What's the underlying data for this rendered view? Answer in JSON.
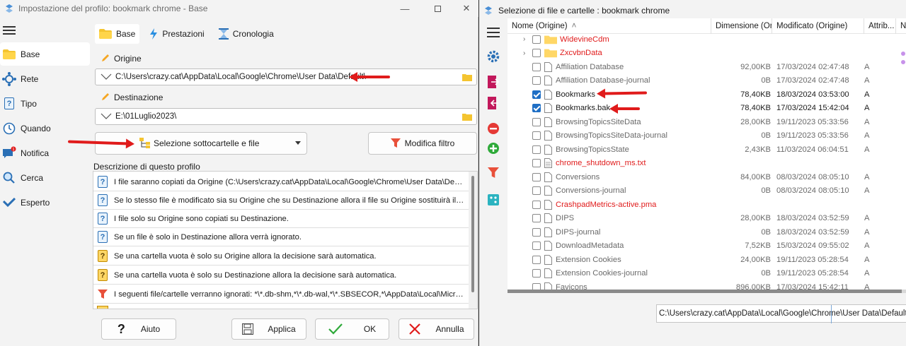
{
  "left_window": {
    "title": "Impostazione del profilo: bookmark chrome - Base",
    "sidebar": [
      {
        "label": "Base",
        "icon": "folder-icon",
        "active": true
      },
      {
        "label": "Rete",
        "icon": "network-icon",
        "active": false
      },
      {
        "label": "Tipo",
        "icon": "question-doc-icon",
        "active": false
      },
      {
        "label": "Quando",
        "icon": "clock-icon",
        "active": false
      },
      {
        "label": "Notifica",
        "icon": "notification-icon",
        "active": false
      },
      {
        "label": "Cerca",
        "icon": "search-icon",
        "active": false
      },
      {
        "label": "Esperto",
        "icon": "check-icon",
        "active": false
      }
    ],
    "tabs": [
      {
        "label": "Base",
        "icon": "folder-icon"
      },
      {
        "label": "Prestazioni",
        "icon": "lightning-icon"
      },
      {
        "label": "Cronologia",
        "icon": "hourglass-icon"
      }
    ],
    "origin_label": "Origine",
    "origin_value": "C:\\Users\\crazy.cat\\AppData\\Local\\Google\\Chrome\\User Data\\Default\\",
    "dest_label": "Destinazione",
    "dest_value": "E:\\01Luglio2023\\",
    "select_button": "Selezione sottocartelle e file",
    "filter_button": "Modifica filtro",
    "desc_title": "Descrizione di questo profilo",
    "descriptions": [
      {
        "text": "I file saranno copiati da Origine (C:\\Users\\crazy.cat\\AppData\\Local\\Google\\Chrome\\User Data\\Default\\) a ...",
        "icon": "question-doc-icon"
      },
      {
        "text": "Se lo stesso file è modificato sia su Origine che su Destinazione allora il file su Origine sostituirà il file su De...",
        "icon": "question-doc-icon"
      },
      {
        "text": "I file solo su Origine sono copiati su Destinazione.",
        "icon": "question-doc-icon"
      },
      {
        "text": "Se un file è solo in Destinazione allora verrà ignorato.",
        "icon": "question-doc-icon"
      },
      {
        "text": "Se una cartella vuota è solo su Origine allora la decisione sarà automatica.",
        "icon": "question-folder-icon"
      },
      {
        "text": "Se una cartella vuota è solo su Destinazione allora la decisione sarà automatica.",
        "icon": "question-folder-icon"
      },
      {
        "text": "I seguenti file/cartelle verranno ignorati: *\\*.db-shm,*\\*.db-wal,*\\*.SBSECOR,*\\AppData\\Local\\Microsoft\\Win...",
        "icon": "filter-icon"
      }
    ],
    "footer": {
      "help": "Aiuto",
      "apply": "Applica",
      "ok": "OK",
      "cancel": "Annulla"
    }
  },
  "right_window": {
    "title": "Selezione di file e cartelle : bookmark chrome",
    "columns": [
      "Nome (Origine)",
      "Dimensione (Ori...",
      "Modificato (Origine)",
      "Attrib...",
      "N"
    ],
    "rows": [
      {
        "name": "WidevineCdm",
        "size": "",
        "modified": "",
        "attr": "",
        "type": "folder",
        "checked": false,
        "style": "red",
        "expand": true
      },
      {
        "name": "ZxcvbnData",
        "size": "",
        "modified": "",
        "attr": "",
        "type": "folder",
        "checked": false,
        "style": "red",
        "expand": true
      },
      {
        "name": "Affiliation Database",
        "size": "92,00KB",
        "modified": "17/03/2024 02:47:48",
        "attr": "A",
        "type": "file",
        "checked": false,
        "style": "gray"
      },
      {
        "name": "Affiliation Database-journal",
        "size": "0B",
        "modified": "17/03/2024 02:47:48",
        "attr": "A",
        "type": "file",
        "checked": false,
        "style": "gray"
      },
      {
        "name": "Bookmarks",
        "size": "78,40KB",
        "modified": "18/03/2024 03:53:00",
        "attr": "A",
        "type": "file",
        "checked": true,
        "style": "dark"
      },
      {
        "name": "Bookmarks.bak",
        "size": "78,40KB",
        "modified": "17/03/2024 15:42:04",
        "attr": "A",
        "type": "file",
        "checked": true,
        "style": "dark"
      },
      {
        "name": "BrowsingTopicsSiteData",
        "size": "28,00KB",
        "modified": "19/11/2023 05:33:56",
        "attr": "A",
        "type": "file",
        "checked": false,
        "style": "gray"
      },
      {
        "name": "BrowsingTopicsSiteData-journal",
        "size": "0B",
        "modified": "19/11/2023 05:33:56",
        "attr": "A",
        "type": "file",
        "checked": false,
        "style": "gray"
      },
      {
        "name": "BrowsingTopicsState",
        "size": "2,43KB",
        "modified": "11/03/2024 06:04:51",
        "attr": "A",
        "type": "file",
        "checked": false,
        "style": "gray"
      },
      {
        "name": "chrome_shutdown_ms.txt",
        "size": "",
        "modified": "",
        "attr": "",
        "type": "textfile",
        "checked": false,
        "style": "red"
      },
      {
        "name": "Conversions",
        "size": "84,00KB",
        "modified": "08/03/2024 08:05:10",
        "attr": "A",
        "type": "file",
        "checked": false,
        "style": "gray"
      },
      {
        "name": "Conversions-journal",
        "size": "0B",
        "modified": "08/03/2024 08:05:10",
        "attr": "A",
        "type": "file",
        "checked": false,
        "style": "gray"
      },
      {
        "name": "CrashpadMetrics-active.pma",
        "size": "",
        "modified": "",
        "attr": "",
        "type": "file",
        "checked": false,
        "style": "red"
      },
      {
        "name": "DIPS",
        "size": "28,00KB",
        "modified": "18/03/2024 03:52:59",
        "attr": "A",
        "type": "file",
        "checked": false,
        "style": "gray"
      },
      {
        "name": "DIPS-journal",
        "size": "0B",
        "modified": "18/03/2024 03:52:59",
        "attr": "A",
        "type": "file",
        "checked": false,
        "style": "gray"
      },
      {
        "name": "DownloadMetadata",
        "size": "7,52KB",
        "modified": "15/03/2024 09:55:02",
        "attr": "A",
        "type": "file",
        "checked": false,
        "style": "gray"
      },
      {
        "name": "Extension Cookies",
        "size": "24,00KB",
        "modified": "19/11/2023 05:28:54",
        "attr": "A",
        "type": "file",
        "checked": false,
        "style": "gray"
      },
      {
        "name": "Extension Cookies-journal",
        "size": "0B",
        "modified": "19/11/2023 05:28:54",
        "attr": "A",
        "type": "file",
        "checked": false,
        "style": "gray"
      },
      {
        "name": "Favicons",
        "size": "896,00KB",
        "modified": "17/03/2024 15:42:11",
        "attr": "A",
        "type": "file",
        "checked": false,
        "style": "gray"
      }
    ],
    "path_value": "C:\\Users\\crazy.cat\\AppData\\Local\\Google\\Chrome\\User Data\\Default\\Favico"
  },
  "colors": {
    "accent": "#1f6fc5",
    "annotation_arrow": "#e01b1b",
    "excluded_text": "#e01b1b"
  }
}
